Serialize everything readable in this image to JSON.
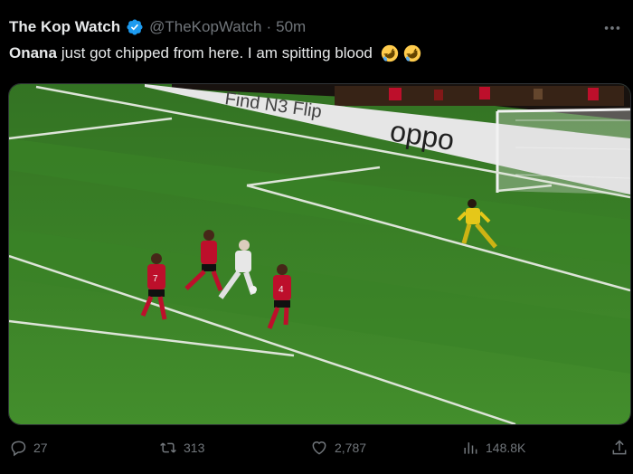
{
  "tweet": {
    "author_name": "The Kop Watch",
    "author_handle": "@TheKopWatch",
    "separator": "·",
    "time_ago": "50m",
    "text_bold": "Onana",
    "text_rest": "just got chipped from here. I am spitting blood",
    "emoji": "rolling-on-floor-laughing x2"
  },
  "media": {
    "board_text_1": "Find N3 Flip",
    "board_text_2": "oppo",
    "shirt_numbers": [
      "7",
      "4"
    ]
  },
  "actions": {
    "replies": "27",
    "retweets": "313",
    "likes": "2,787",
    "views": "148.8K"
  },
  "colors": {
    "background": "#000000",
    "text": "#e7e9ea",
    "muted": "#71767b",
    "verified": "#1d9bf0",
    "pitch": "#3f8a2c",
    "home_kit": "#c8102e",
    "keeper_kit": "#f2d21b"
  }
}
